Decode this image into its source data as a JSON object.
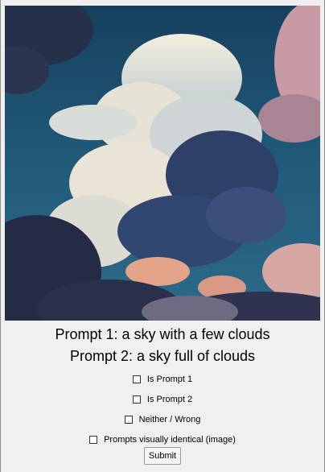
{
  "image": {
    "subject": "painted sky full of clouds",
    "colors": {
      "sky": "#1f4b6b",
      "cloud_light": "#e8e2d2",
      "cloud_dark": "#2b2f4d",
      "cloud_pink": "#c99aa6"
    }
  },
  "prompts": {
    "prompt1": "Prompt 1: a sky with a few clouds",
    "prompt2": "Prompt 2: a sky full of clouds"
  },
  "options": [
    {
      "label": "Is Prompt 1",
      "checked": false
    },
    {
      "label": "Is Prompt 2",
      "checked": false
    },
    {
      "label": "Neither / Wrong",
      "checked": false
    },
    {
      "label": "Prompts visually identical (image)",
      "checked": false
    }
  ],
  "submit_label": "Submit"
}
